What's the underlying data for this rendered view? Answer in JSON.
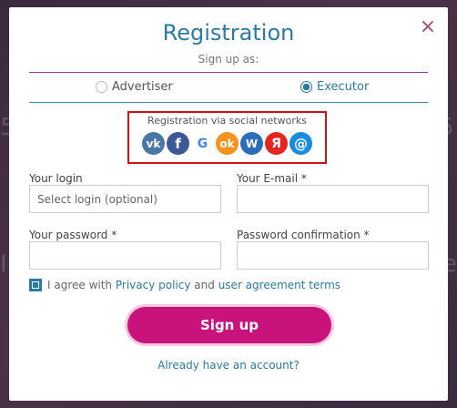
{
  "modal": {
    "title": "Registration",
    "subtitle": "Sign up as:",
    "close_icon": "×"
  },
  "roles": {
    "options": [
      "Advertiser",
      "Executor"
    ],
    "selected": "Executor"
  },
  "social": {
    "label": "Registration via social networks",
    "icons": [
      {
        "name": "vk-icon",
        "glyph": "vk",
        "color": "#4a76a8"
      },
      {
        "name": "facebook-icon",
        "glyph": "f",
        "color": "#3b5998"
      },
      {
        "name": "google-icon",
        "glyph": "G",
        "color": "#ffffff"
      },
      {
        "name": "odnoklassniki-icon",
        "glyph": "ok",
        "color": "#f7931e"
      },
      {
        "name": "webmoney-icon",
        "glyph": "W",
        "color": "#2a6ebb"
      },
      {
        "name": "yandex-icon",
        "glyph": "Я",
        "color": "#e52620"
      },
      {
        "name": "mailru-icon",
        "glyph": "@",
        "color": "#168de2"
      }
    ]
  },
  "form": {
    "login_label": "Your login",
    "login_placeholder": "Select login (optional)",
    "email_label": "Your E-mail *",
    "password_label": "Your password *",
    "password_confirm_label": "Password confirmation *"
  },
  "agreement": {
    "prefix": "I agree with",
    "privacy_link": "Privacy policy",
    "and": "and",
    "terms_link": "user agreement terms",
    "checked": true
  },
  "signup_button": "Sign up",
  "already_link": "Already have an account?"
}
